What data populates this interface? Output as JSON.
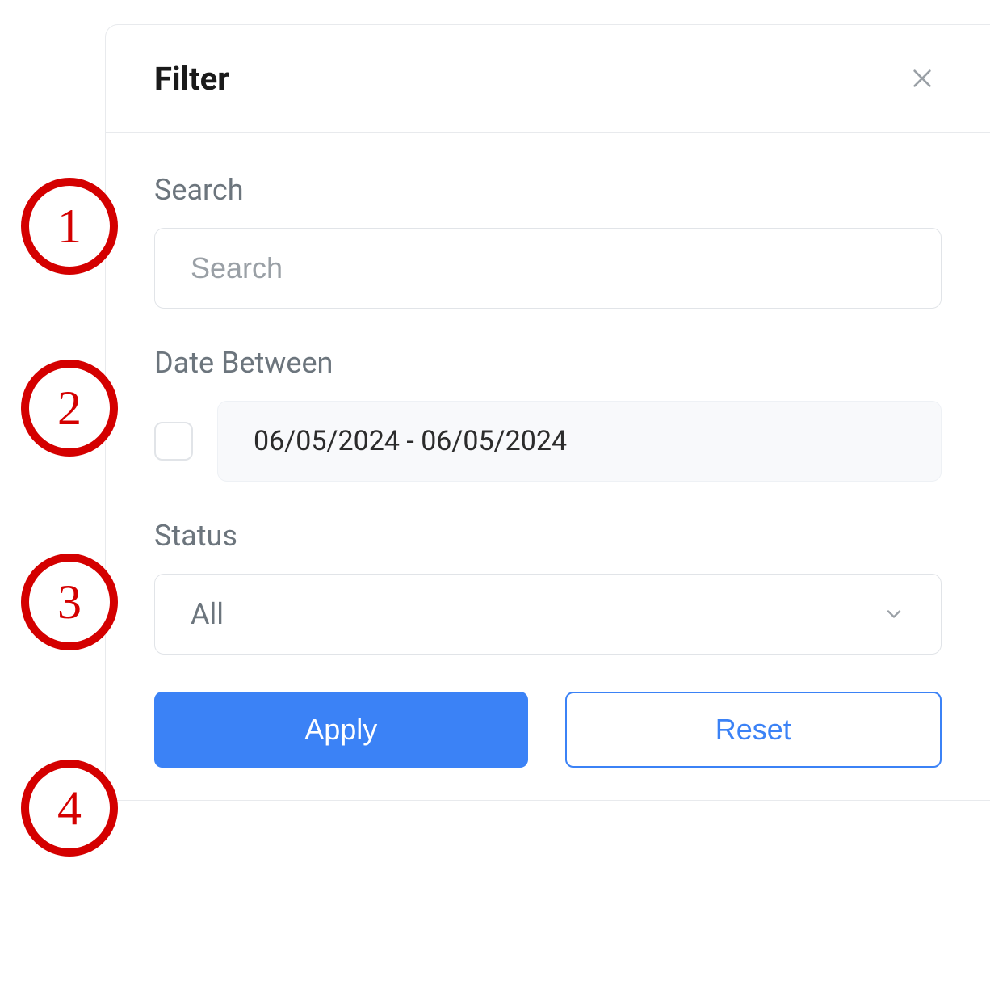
{
  "panel": {
    "title": "Filter"
  },
  "fields": {
    "search": {
      "label": "Search",
      "placeholder": "Search",
      "value": ""
    },
    "date": {
      "label": "Date Between",
      "value": "06/05/2024 - 06/05/2024",
      "checked": false
    },
    "status": {
      "label": "Status",
      "selected": "All"
    }
  },
  "buttons": {
    "apply": "Apply",
    "reset": "Reset"
  },
  "annotations": {
    "n1": "1",
    "n2": "2",
    "n3": "3",
    "n4": "4"
  }
}
